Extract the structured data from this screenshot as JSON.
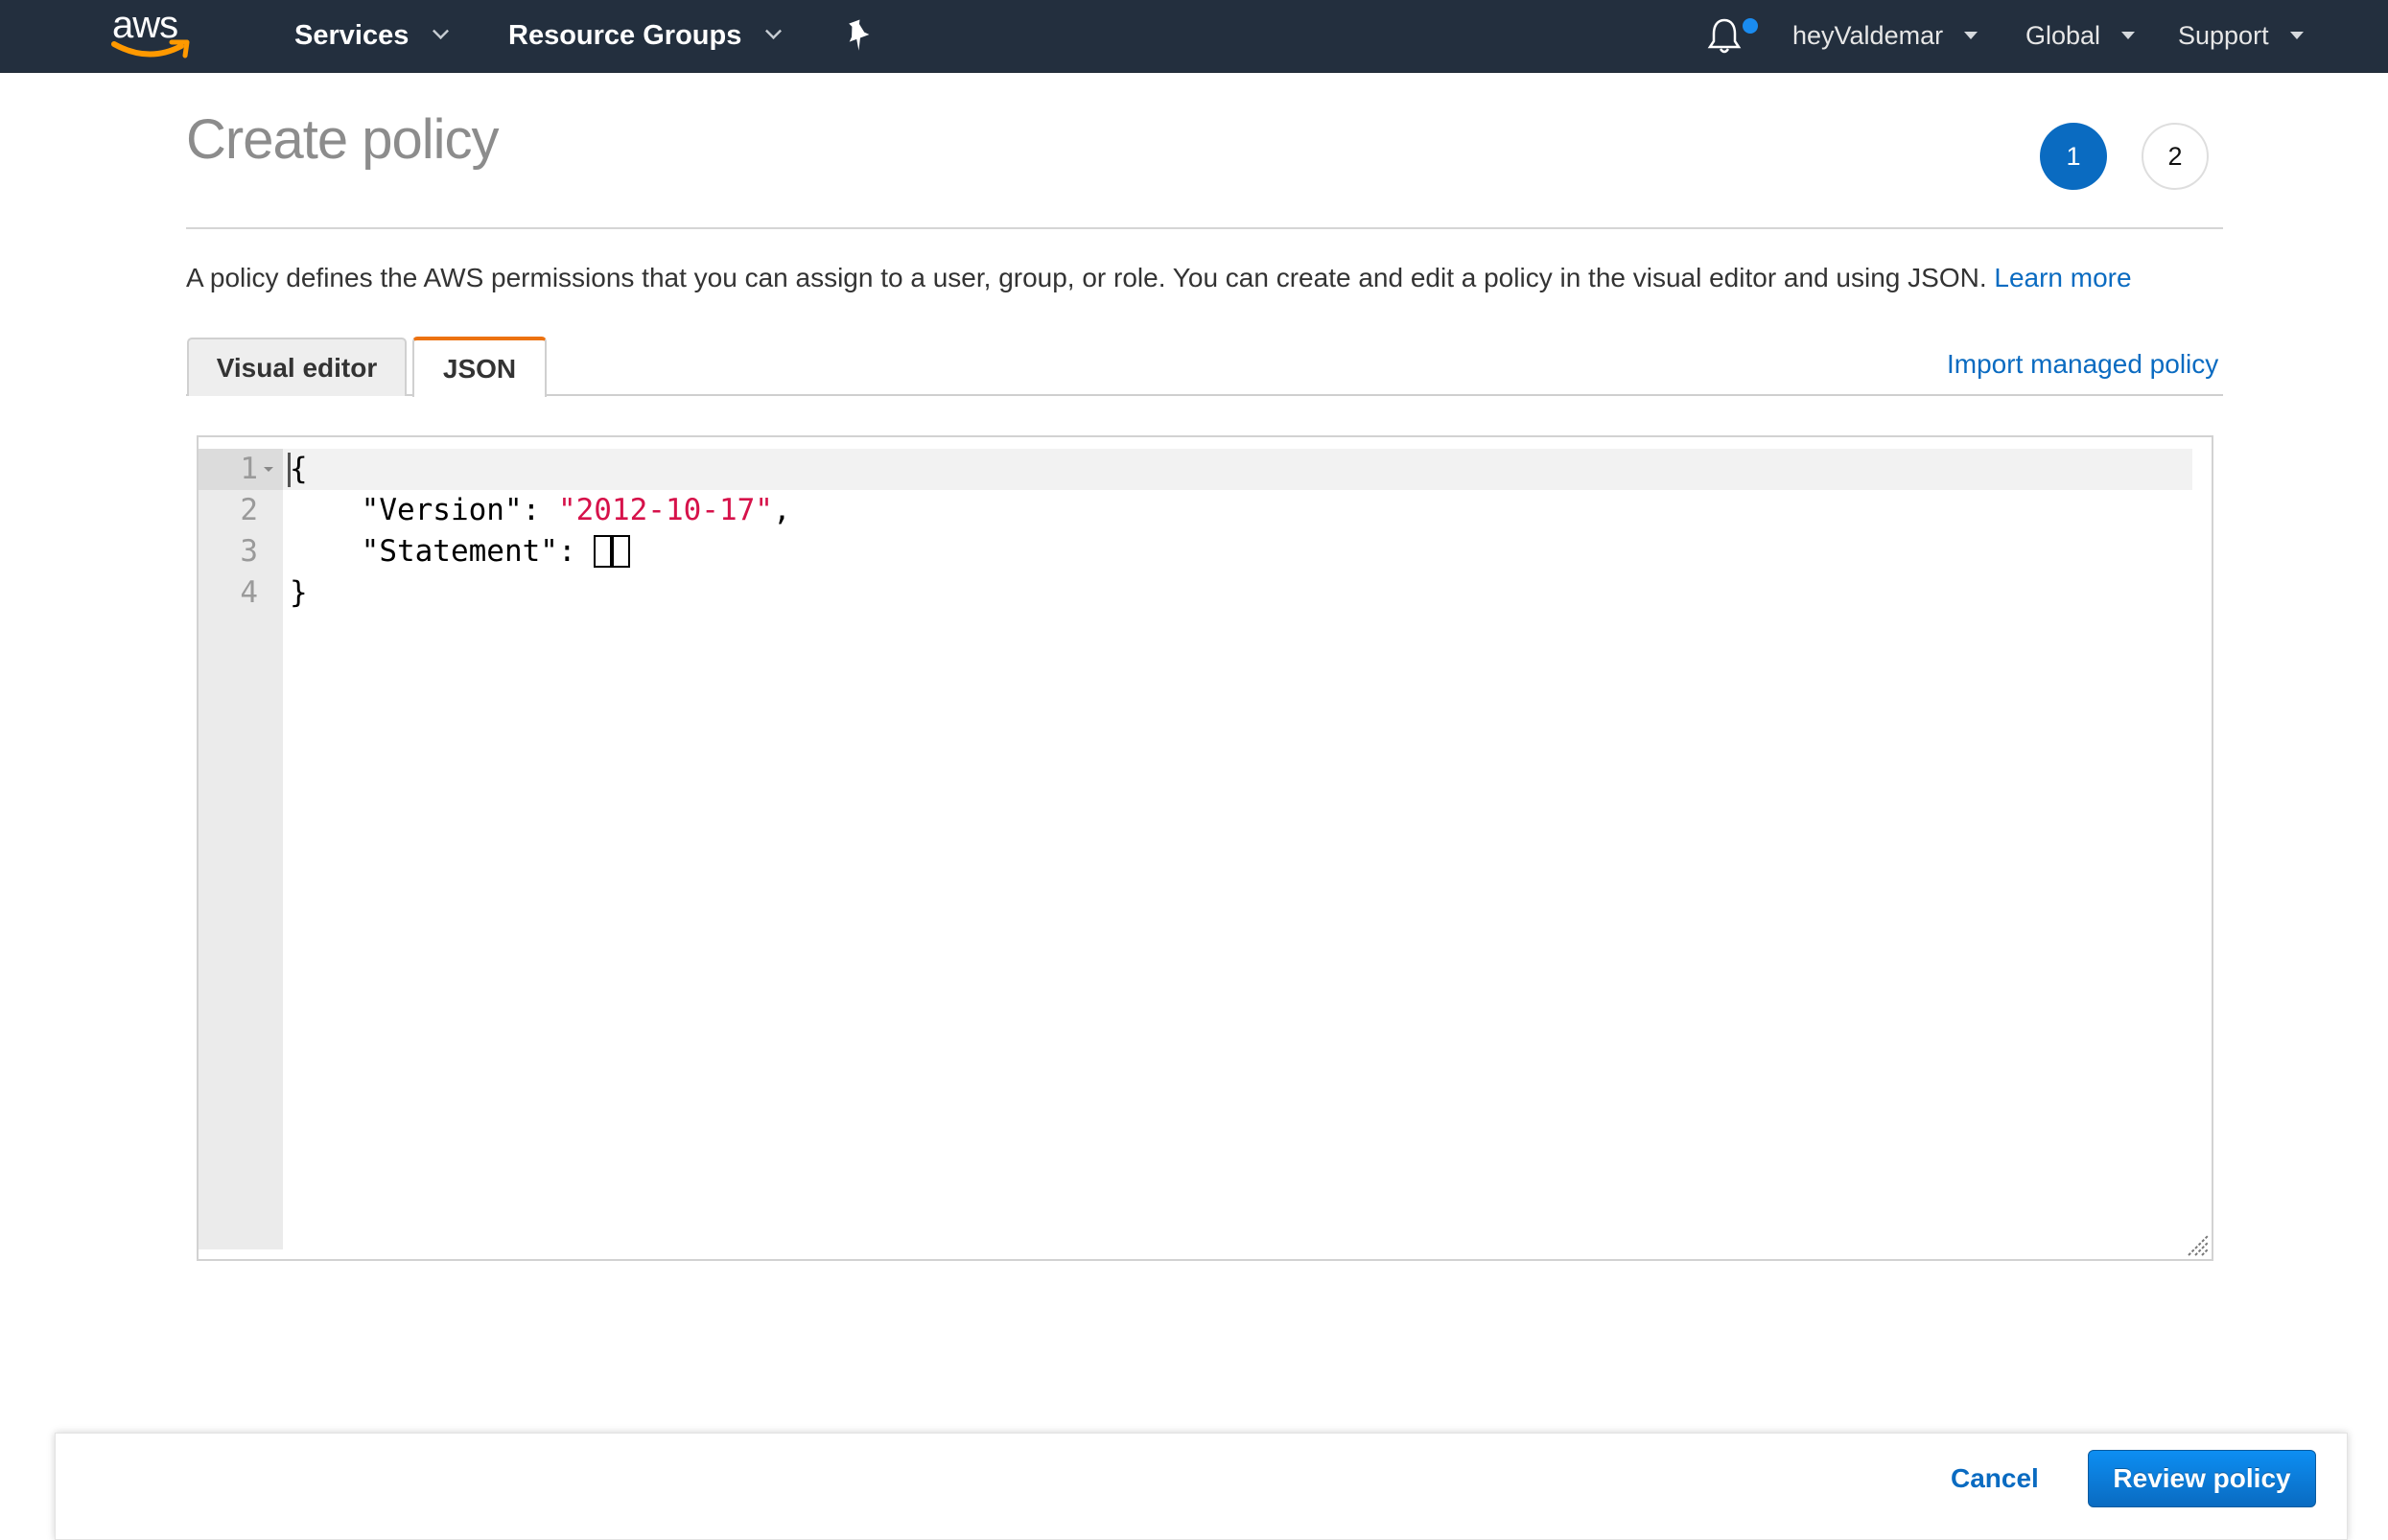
{
  "nav": {
    "logo_text": "aws",
    "services_label": "Services",
    "resource_groups_label": "Resource Groups",
    "pin_icon": "pushpin-icon",
    "bell_icon": "bell-icon",
    "notification_dot_color": "#1a8cf0",
    "account_label": "heyValdemar",
    "region_label": "Global",
    "support_label": "Support"
  },
  "page": {
    "title": "Create policy",
    "steps": [
      "1",
      "2"
    ],
    "current_step": 1,
    "description": "A policy defines the AWS permissions that you can assign to a user, group, or role. You can create and edit a policy in the visual editor and using JSON.",
    "learn_more_label": "Learn more"
  },
  "tabs": {
    "items": [
      {
        "label": "Visual editor",
        "active": false
      },
      {
        "label": "JSON",
        "active": true
      }
    ],
    "import_label": "Import managed policy"
  },
  "editor": {
    "line_numbers": [
      "1",
      "2",
      "3",
      "4"
    ],
    "lines": [
      {
        "text": "{"
      },
      {
        "indent": "    ",
        "key": "\"Version\"",
        "sep": ": ",
        "value": "\"2012-10-17\"",
        "tail": ","
      },
      {
        "indent": "    ",
        "key": "\"Statement\"",
        "sep": ": ",
        "open": "[",
        "close": "]"
      },
      {
        "text": "}"
      }
    ],
    "colors": {
      "string": "#d6124a",
      "accent_tab": "#ec7211"
    }
  },
  "footer": {
    "cancel_label": "Cancel",
    "review_label": "Review policy"
  }
}
